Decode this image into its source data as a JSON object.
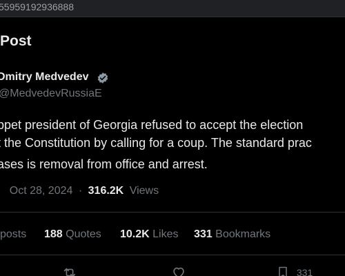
{
  "browser": {
    "url_fragment": "55959192936888"
  },
  "header": {
    "title": "Post"
  },
  "author": {
    "name": "Dmitry Medvedev",
    "handle": "@MedvedevRussiaE"
  },
  "tweet": {
    "lines": [
      "ppet president of Georgia refused to accept the election",
      "t the Constitution by calling for a coup. The standard prac",
      "ases is removal from office and arrest."
    ]
  },
  "meta": {
    "separator_start": "·",
    "date": "Oct 28, 2024",
    "separator": "·",
    "views_count": "316.2K",
    "views_label": "Views"
  },
  "stats": {
    "reposts_label": "posts",
    "quotes_count": "188",
    "quotes_label": "Quotes",
    "likes_count": "10.2K",
    "likes_label": "Likes",
    "bookmarks_count": "331",
    "bookmarks_label": "Bookmarks"
  },
  "actions": {
    "bookmark_count": "331"
  },
  "colors": {
    "background": "#000000",
    "text_primary": "#e7e9ea",
    "text_secondary": "#71767b",
    "verified_blue": "#1d9bf0",
    "divider": "#2f3336"
  }
}
